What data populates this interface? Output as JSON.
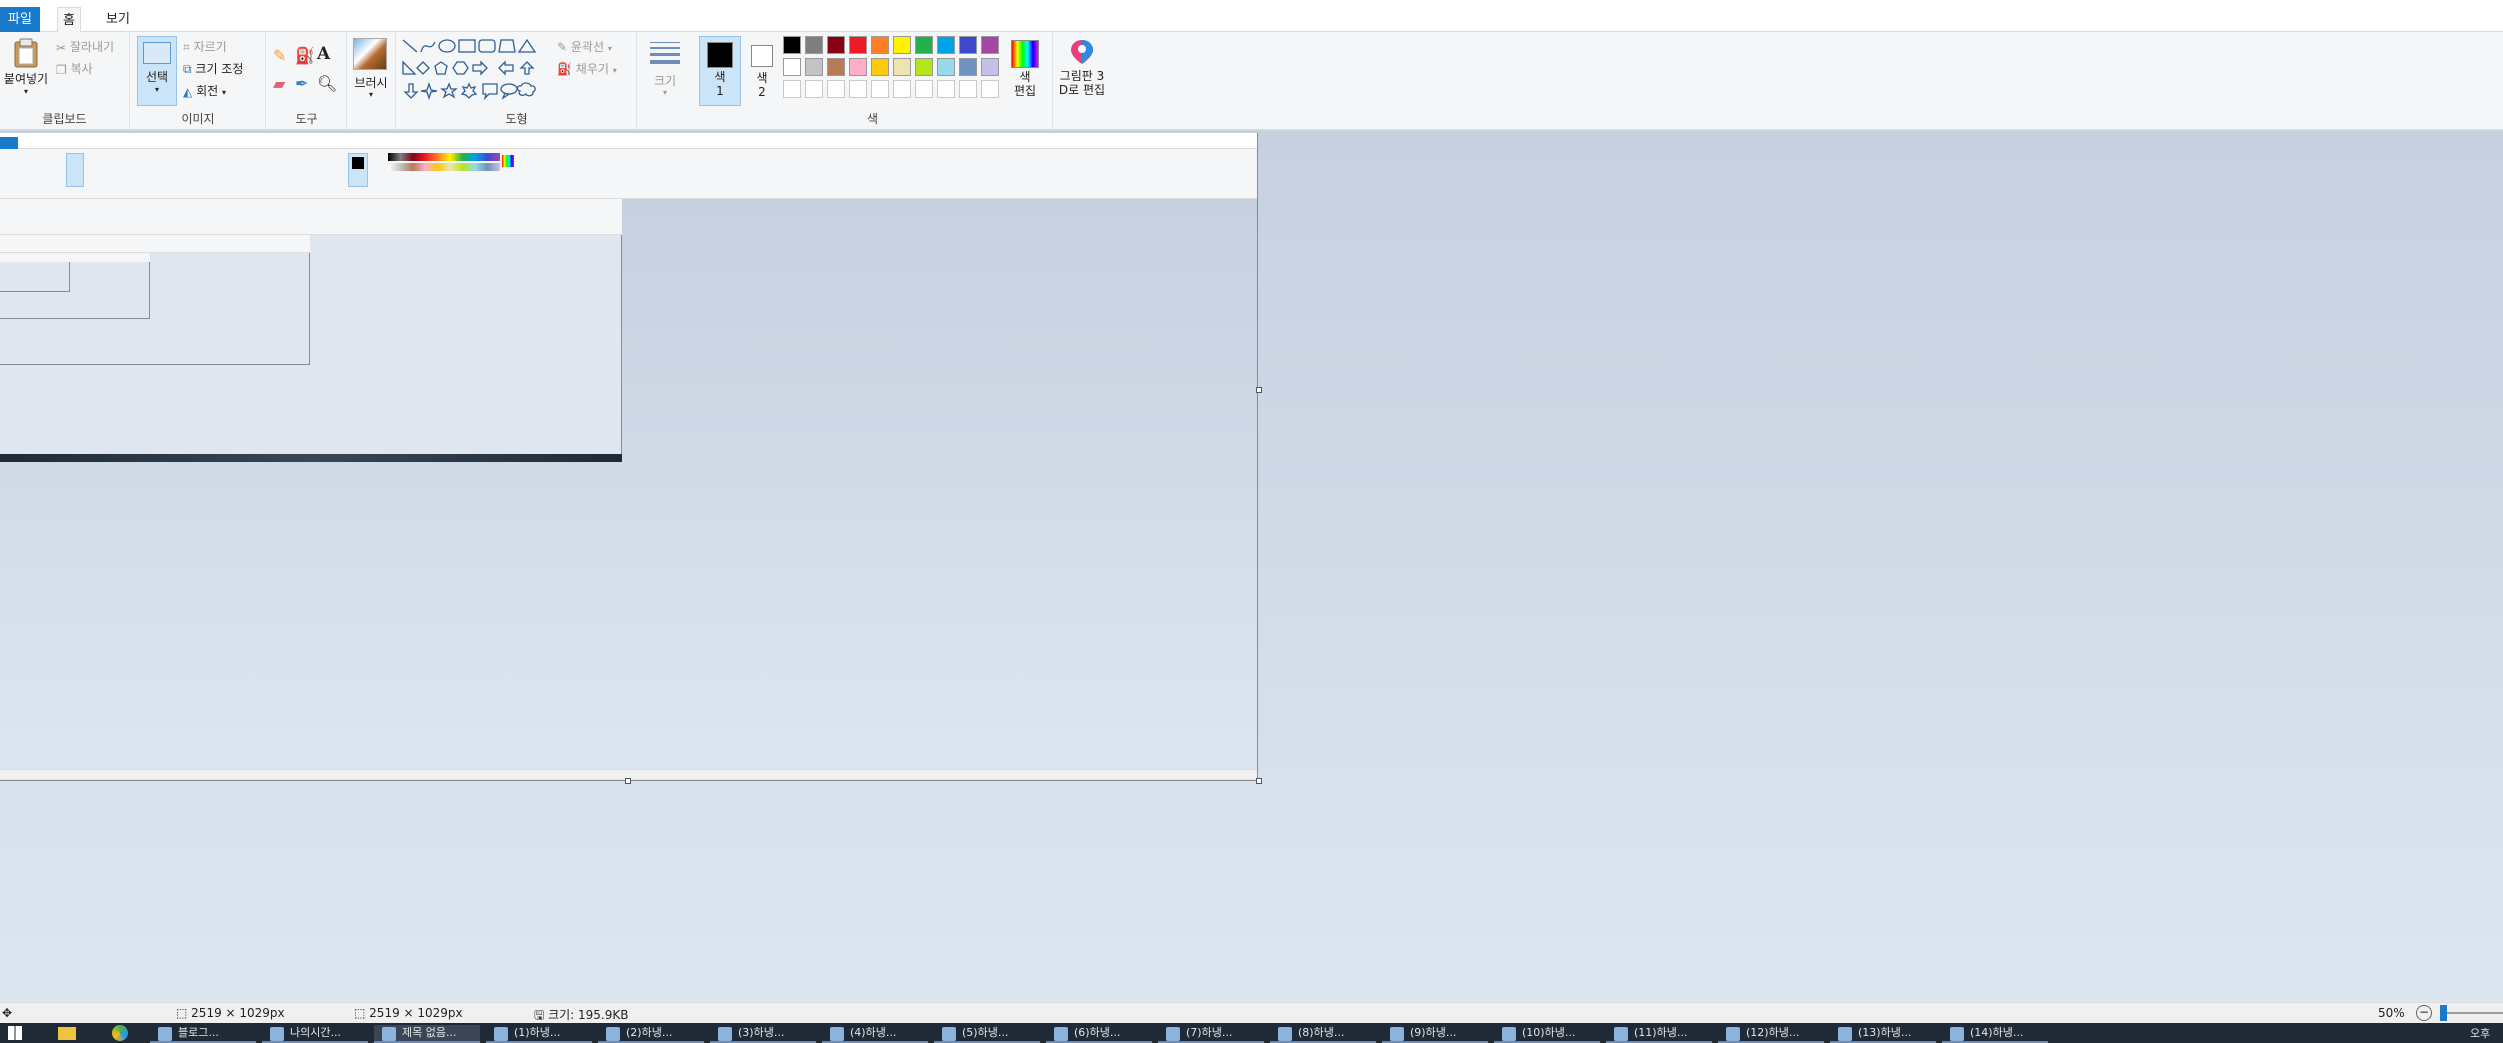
{
  "menu": {
    "file": "파일",
    "home": "홈",
    "view": "보기"
  },
  "clipboard": {
    "paste": "붙여넣기",
    "cut": "잘라내기",
    "copy": "복사",
    "label": "클립보드"
  },
  "image": {
    "select": "선택",
    "crop": "자르기",
    "resize": "크기 조정",
    "rotate": "회전",
    "label": "이미지"
  },
  "tools": {
    "label": "도구"
  },
  "brushes": {
    "label": "브러시"
  },
  "shapes": {
    "outline": "윤곽선",
    "fill": "채우기",
    "label": "도형"
  },
  "size": {
    "label": "크기"
  },
  "colors": {
    "color1": "색\n1",
    "color2": "색\n2",
    "edit": "색\n편집",
    "label": "색",
    "color1_value": "#000000",
    "color2_value": "#ffffff",
    "row1": [
      "#000000",
      "#7f7f7f",
      "#880015",
      "#ed1c24",
      "#ff7f27",
      "#fff200",
      "#22b14c",
      "#00a2e8",
      "#3f48cc",
      "#a349a4"
    ],
    "row2": [
      "#ffffff",
      "#c3c3c3",
      "#b97a57",
      "#ffaec9",
      "#ffc90e",
      "#efe4b0",
      "#b5e61d",
      "#99d9ea",
      "#7092be",
      "#c8bfe7"
    ]
  },
  "paint3d": {
    "label": "그림판 3\nD로 편집"
  },
  "status": {
    "cursor_pos": "2519 × 1029px",
    "selection_size": "2519 × 1029px",
    "file_size": "크기: 195.9KB",
    "zoom": "50%",
    "zoom_level": 0.5
  },
  "taskbar": {
    "items": [
      "블로그...",
      "나의시간...",
      "제목 없음...",
      "(1)하냉...",
      "(2)하냉...",
      "(3)하냉...",
      "(4)하냉...",
      "(5)하냉...",
      "(6)하냉...",
      "(7)하냉...",
      "(8)하냉...",
      "(9)하냉...",
      "(10)하냉...",
      "(11)하냉...",
      "(12)하냉...",
      "(13)하냉...",
      "(14)하냉..."
    ],
    "clock": "오후"
  }
}
